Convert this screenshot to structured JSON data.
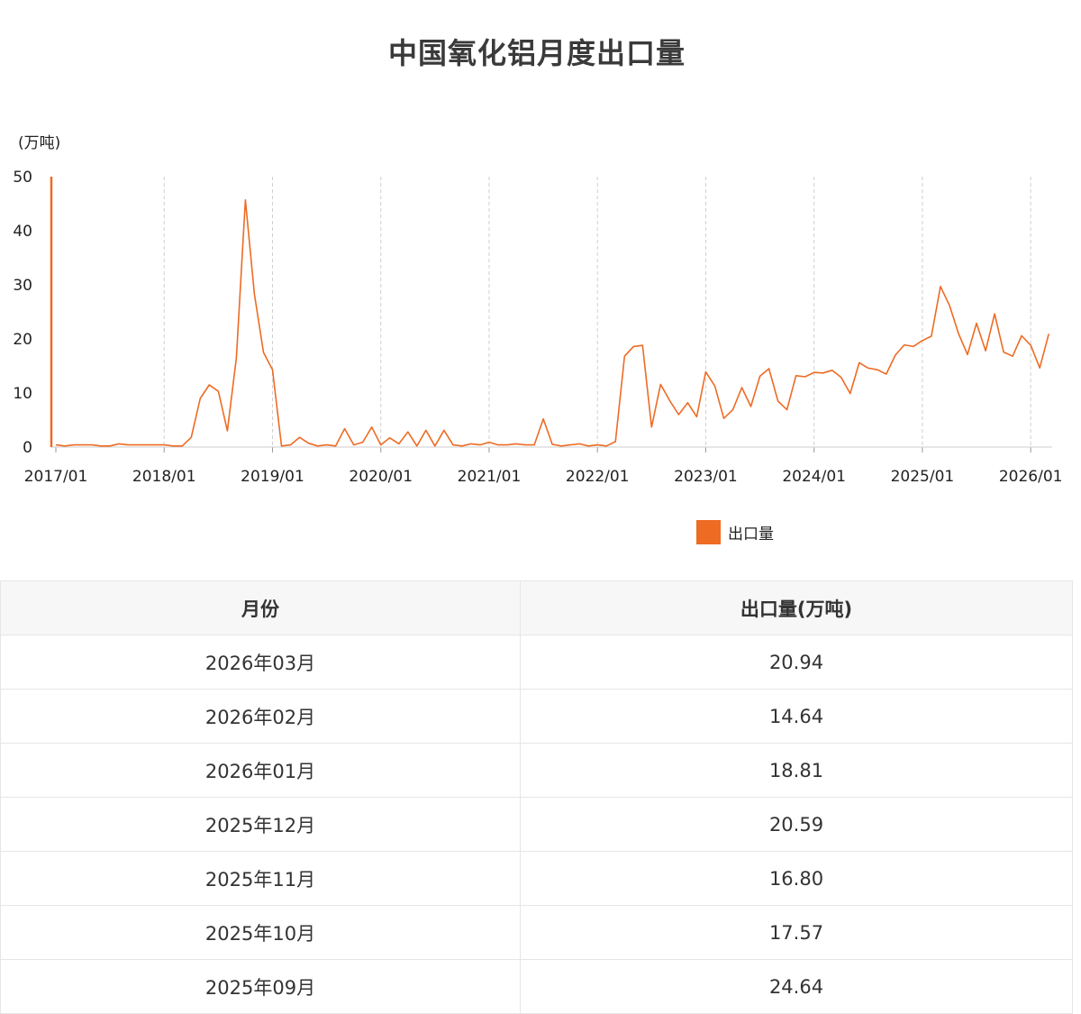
{
  "page": {
    "title": "中国氧化铝月度出口量"
  },
  "chart_data": {
    "type": "line",
    "title": "中国氧化铝月度出口量",
    "ylabel": "(万吨)",
    "ylim": [
      0,
      50
    ],
    "yticks": [
      "0",
      "10",
      "20",
      "30",
      "40",
      "50"
    ],
    "xtick_labels": [
      "2017/01",
      "2018/01",
      "2019/01",
      "2020/01",
      "2021/01",
      "2022/01",
      "2023/01",
      "2024/01",
      "2025/01",
      "2026/01"
    ],
    "grid": "vertical dashed",
    "legend_position": "bottom-center",
    "series": [
      {
        "name": "出口量",
        "color": "#ee6b24",
        "x": [
          "2017/01",
          "2017/02",
          "2017/03",
          "2017/04",
          "2017/05",
          "2017/06",
          "2017/07",
          "2017/08",
          "2017/09",
          "2017/10",
          "2017/11",
          "2017/12",
          "2018/01",
          "2018/02",
          "2018/03",
          "2018/04",
          "2018/05",
          "2018/06",
          "2018/07",
          "2018/08",
          "2018/09",
          "2018/10",
          "2018/11",
          "2018/12",
          "2019/01",
          "2019/02",
          "2019/03",
          "2019/04",
          "2019/05",
          "2019/06",
          "2019/07",
          "2019/08",
          "2019/09",
          "2019/10",
          "2019/11",
          "2019/12",
          "2020/01",
          "2020/02",
          "2020/03",
          "2020/04",
          "2020/05",
          "2020/06",
          "2020/07",
          "2020/08",
          "2020/09",
          "2020/10",
          "2020/11",
          "2020/12",
          "2021/01",
          "2021/02",
          "2021/03",
          "2021/04",
          "2021/05",
          "2021/06",
          "2021/07",
          "2021/08",
          "2021/09",
          "2021/10",
          "2021/11",
          "2021/12",
          "2022/01",
          "2022/02",
          "2022/03",
          "2022/04",
          "2022/05",
          "2022/06",
          "2022/07",
          "2022/08",
          "2022/09",
          "2022/10",
          "2022/11",
          "2022/12",
          "2023/01",
          "2023/02",
          "2023/03",
          "2023/04",
          "2023/05",
          "2023/06",
          "2023/07",
          "2023/08",
          "2023/09",
          "2023/10",
          "2023/11",
          "2023/12",
          "2024/01",
          "2024/02",
          "2024/03",
          "2024/04",
          "2024/05",
          "2024/06",
          "2024/07",
          "2024/08",
          "2024/09",
          "2024/10",
          "2024/11",
          "2024/12",
          "2025/01",
          "2025/02",
          "2025/03",
          "2025/04",
          "2025/05",
          "2025/06",
          "2025/07",
          "2025/08",
          "2025/09",
          "2025/10",
          "2025/11",
          "2025/12",
          "2026/01",
          "2026/02",
          "2026/03"
        ],
        "values": [
          0.4,
          0.2,
          0.4,
          0.4,
          0.4,
          0.2,
          0.2,
          0.6,
          0.4,
          0.4,
          0.4,
          0.4,
          0.4,
          0.2,
          0.2,
          1.8,
          9.0,
          11.5,
          10.3,
          3.0,
          16.5,
          45.7,
          28.3,
          17.5,
          14.3,
          0.2,
          0.4,
          1.8,
          0.7,
          0.2,
          0.4,
          0.2,
          3.4,
          0.4,
          0.9,
          3.7,
          0.4,
          1.7,
          0.6,
          2.8,
          0.2,
          3.1,
          0.2,
          3.1,
          0.4,
          0.2,
          0.6,
          0.4,
          0.9,
          0.4,
          0.4,
          0.6,
          0.4,
          0.4,
          5.2,
          0.5,
          0.2,
          0.4,
          0.6,
          0.2,
          0.4,
          0.2,
          1.0,
          16.8,
          18.6,
          18.8,
          3.7,
          11.6,
          8.6,
          6.0,
          8.2,
          5.6,
          13.9,
          11.3,
          5.3,
          6.9,
          11.0,
          7.5,
          13.1,
          14.5,
          8.5,
          6.9,
          13.2,
          13.0,
          13.8,
          13.7,
          14.2,
          12.9,
          9.9,
          15.6,
          14.6,
          14.3,
          13.5,
          17.0,
          18.9,
          18.6,
          19.7,
          20.5,
          29.7,
          26.2,
          21.0,
          17.1,
          22.9,
          17.8,
          24.64,
          17.57,
          16.8,
          20.59,
          18.81,
          14.64,
          20.94
        ]
      }
    ]
  },
  "legend": {
    "label": "出口量",
    "color": "#ee6b24"
  },
  "table": {
    "headers": [
      "月份",
      "出口量(万吨)"
    ],
    "rows": [
      [
        "2026年03月",
        "20.94"
      ],
      [
        "2026年02月",
        "14.64"
      ],
      [
        "2026年01月",
        "18.81"
      ],
      [
        "2025年12月",
        "20.59"
      ],
      [
        "2025年11月",
        "16.80"
      ],
      [
        "2025年10月",
        "17.57"
      ],
      [
        "2025年09月",
        "24.64"
      ]
    ]
  }
}
